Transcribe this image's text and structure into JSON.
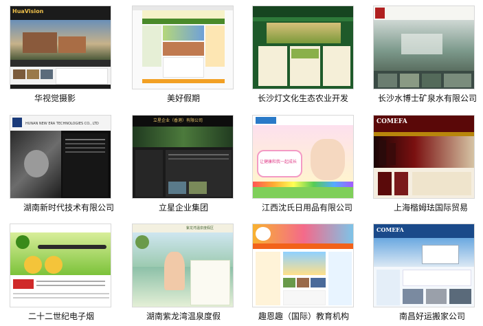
{
  "items": [
    {
      "caption": "华视觉摄影",
      "thumb_text": "HuaVision"
    },
    {
      "caption": "美好假期",
      "thumb_text": ""
    },
    {
      "caption": "长沙灯文化生态农业开发",
      "thumb_text": ""
    },
    {
      "caption": "长沙水博士矿泉水有限公司",
      "thumb_text": ""
    },
    {
      "caption": "湖南新时代技术有限公司",
      "thumb_text": "HUNAN NEW ERA TECHNOLOGIES CO., LTD"
    },
    {
      "caption": "立星企业集团",
      "thumb_text": "立星企业（香港）有限公司"
    },
    {
      "caption": "江西沈氏日用品有限公司",
      "thumb_text": "让健康和我一起成长"
    },
    {
      "caption": "上海楷姆珐国际贸易",
      "thumb_text": "COMEFA"
    },
    {
      "caption": "二十二世纪电子烟",
      "thumb_text": ""
    },
    {
      "caption": "湖南紫龙湾温泉度假",
      "thumb_text": "紫龙湾温泉度假区"
    },
    {
      "caption": "趣恩趣（国际）教育机构",
      "thumb_text": ""
    },
    {
      "caption": "南昌好运搬家公司",
      "thumb_text": "COMEFA"
    }
  ]
}
